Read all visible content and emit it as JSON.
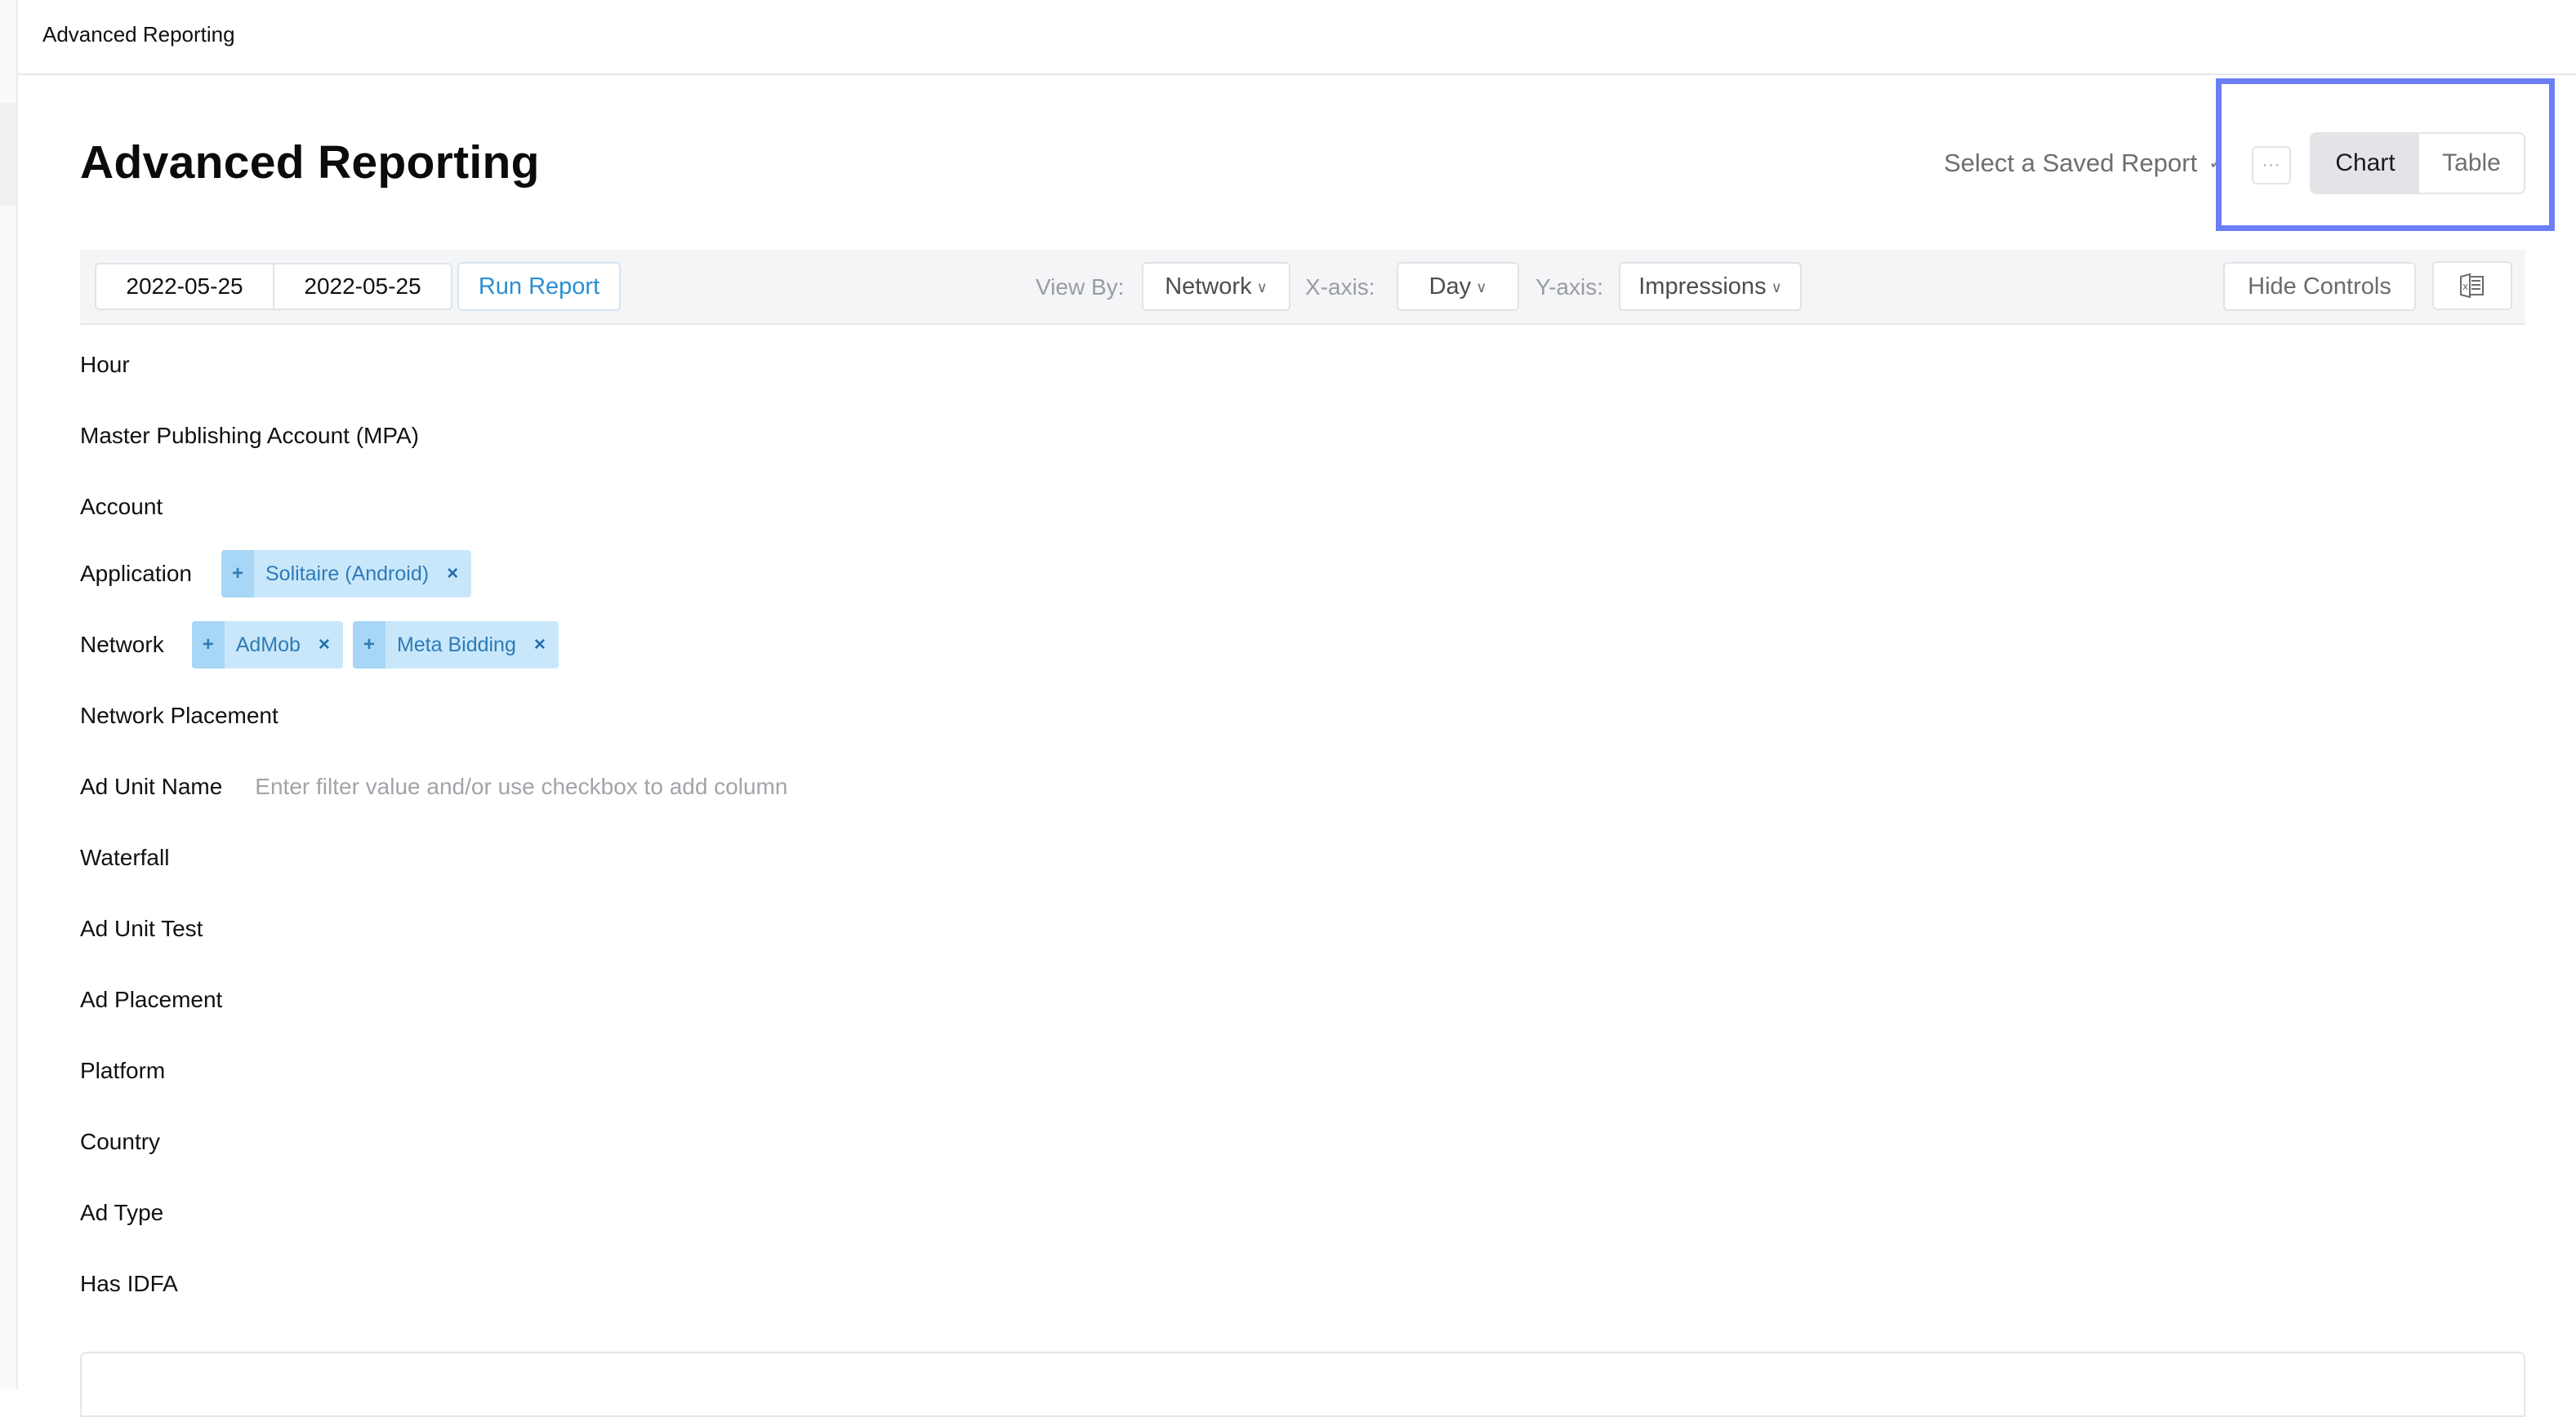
{
  "topbar": {
    "breadcrumb": "Advanced Reporting"
  },
  "header": {
    "title": "Advanced Reporting",
    "saved_report_placeholder": "Select a Saved Report",
    "more_label": "···",
    "view_toggle": {
      "options": [
        "Chart",
        "Table"
      ],
      "selected": "Chart"
    },
    "highlight_color": "#6b7ef5"
  },
  "toolbar": {
    "start_date": "2022-05-25",
    "end_date": "2022-05-25",
    "run_report_label": "Run Report",
    "view_by_label": "View By:",
    "view_by_value": "Network",
    "x_axis_label": "X-axis:",
    "x_axis_value": "Day",
    "y_axis_label": "Y-axis:",
    "y_axis_value": "Impressions",
    "hide_controls_label": "Hide Controls",
    "export_icon": "excel-icon"
  },
  "filters": [
    {
      "label": "Hour",
      "chips": []
    },
    {
      "label": "Master Publishing Account (MPA)",
      "chips": []
    },
    {
      "label": "Account",
      "chips": []
    },
    {
      "label": "Application",
      "chips": [
        "Solitaire (Android)"
      ]
    },
    {
      "label": "Network",
      "chips": [
        "AdMob",
        "Meta Bidding"
      ]
    },
    {
      "label": "Network Placement",
      "chips": []
    },
    {
      "label": "Ad Unit Name",
      "chips": [],
      "placeholder": "Enter filter value and/or use checkbox to add column"
    },
    {
      "label": "Waterfall",
      "chips": []
    },
    {
      "label": "Ad Unit Test",
      "chips": []
    },
    {
      "label": "Ad Placement",
      "chips": []
    },
    {
      "label": "Platform",
      "chips": []
    },
    {
      "label": "Country",
      "chips": []
    },
    {
      "label": "Ad Type",
      "chips": []
    },
    {
      "label": "Has IDFA",
      "chips": []
    }
  ],
  "chip_icons": {
    "add": "+",
    "remove": "×"
  },
  "colors": {
    "accent_link": "#2b8ed1",
    "chip_bg": "#c9e7fb",
    "chip_plus_bg": "#a7d6f6",
    "chip_text": "#2f7bb6"
  }
}
